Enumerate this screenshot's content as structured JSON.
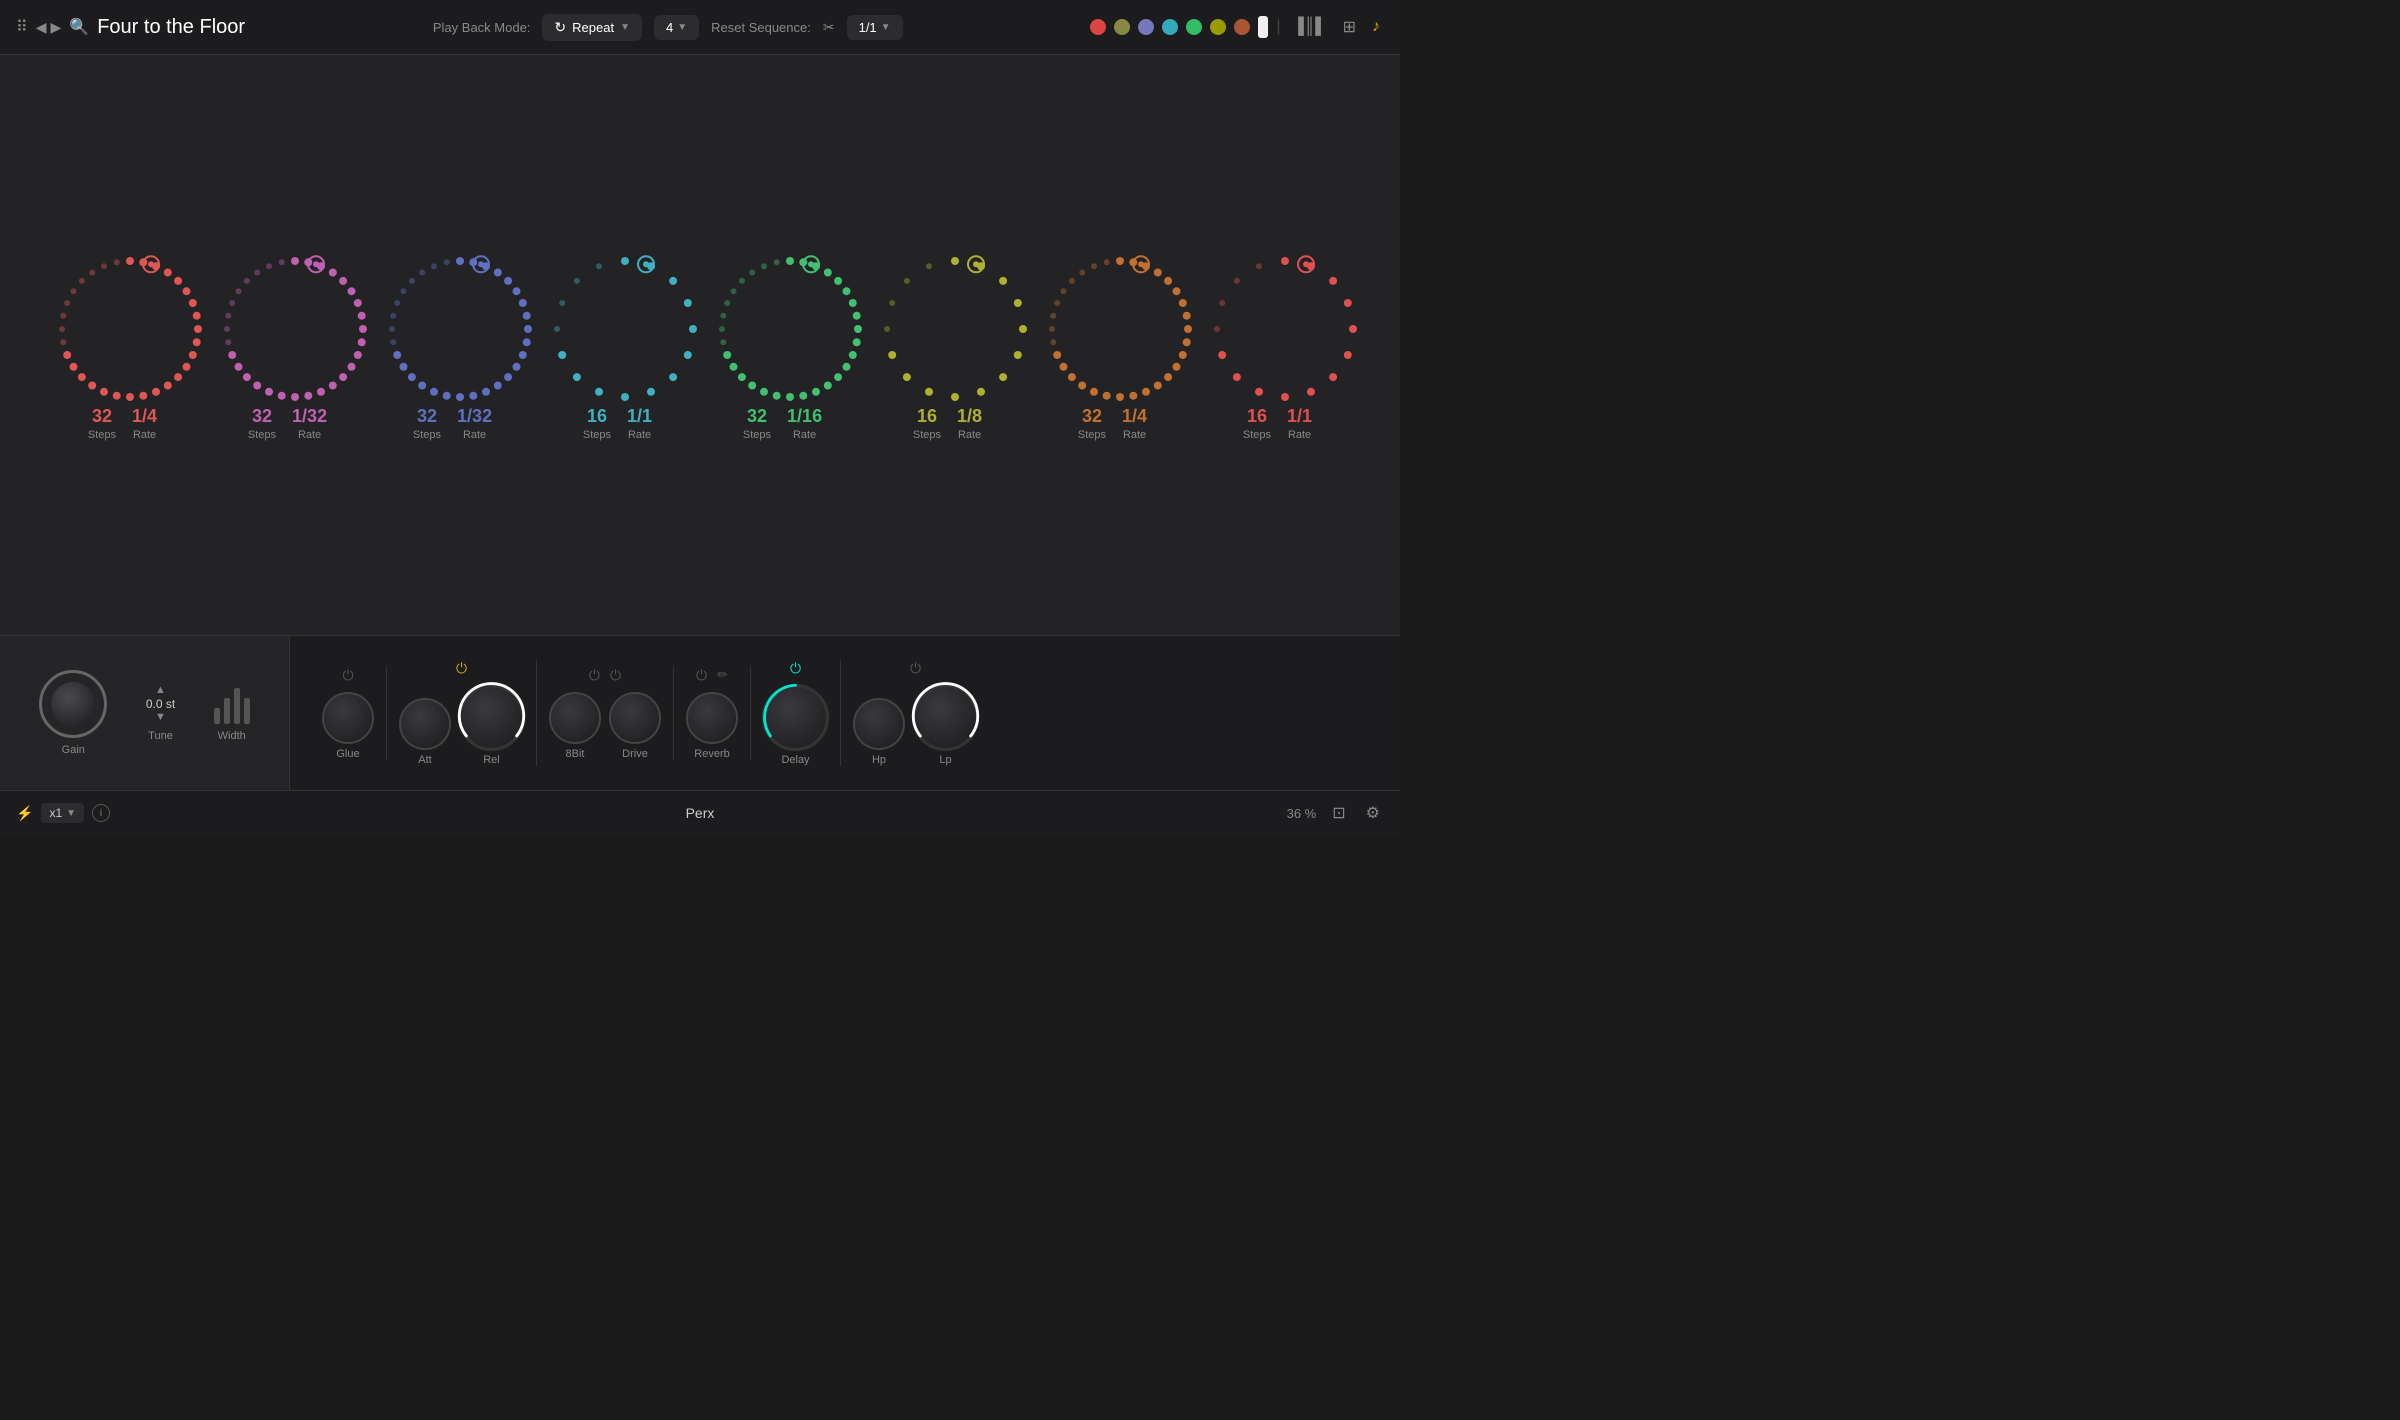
{
  "app": {
    "title": "Four to the Floor"
  },
  "topbar": {
    "playback_label": "Play Back Mode:",
    "playback_mode": "Repeat",
    "steps_value": "4",
    "reset_label": "Reset Sequence:",
    "reset_value": "1/1"
  },
  "colors": {
    "track_dots": [
      "#e05555",
      "#c060b0",
      "#6070c0",
      "#40b0c0",
      "#40c070",
      "#b0b030",
      "#c07030",
      "#e05050"
    ],
    "tracks": [
      {
        "color": "#e05555",
        "steps": "32",
        "rate": "1/4"
      },
      {
        "color": "#c060b0",
        "steps": "32",
        "rate": "1/32"
      },
      {
        "color": "#6070c0",
        "steps": "32",
        "rate": "1/32"
      },
      {
        "color": "#40b0c0",
        "steps": "16",
        "rate": "1/1"
      },
      {
        "color": "#40c070",
        "steps": "32",
        "rate": "1/16"
      },
      {
        "color": "#b0b030",
        "steps": "16",
        "rate": "1/8"
      },
      {
        "color": "#c07030",
        "steps": "32",
        "rate": "1/4"
      },
      {
        "color": "#e05050",
        "steps": "16",
        "rate": "1/1"
      }
    ]
  },
  "fx": {
    "gain_label": "Gain",
    "tune_label": "Tune",
    "tune_value": "0.0 st",
    "width_label": "Width",
    "glue_label": "Glue",
    "att_label": "Att",
    "rel_label": "Rel",
    "bit_label": "8Bit",
    "drive_label": "Drive",
    "reverb_label": "Reverb",
    "delay_label": "Delay",
    "hp_label": "Hp",
    "lp_label": "Lp"
  },
  "status": {
    "mult": "x1",
    "instrument": "Perx",
    "zoom": "36 %"
  },
  "header_colors": [
    {
      "color": "#d44",
      "label": "track1"
    },
    {
      "color": "#884",
      "label": "track2"
    },
    {
      "color": "#77b",
      "label": "track3"
    },
    {
      "color": "#3ab",
      "label": "track4"
    },
    {
      "color": "#3b6",
      "label": "track5"
    },
    {
      "color": "#990",
      "label": "track6"
    },
    {
      "color": "#a53",
      "label": "track7"
    },
    {
      "color": "#f0f0f0",
      "label": "track8"
    }
  ]
}
